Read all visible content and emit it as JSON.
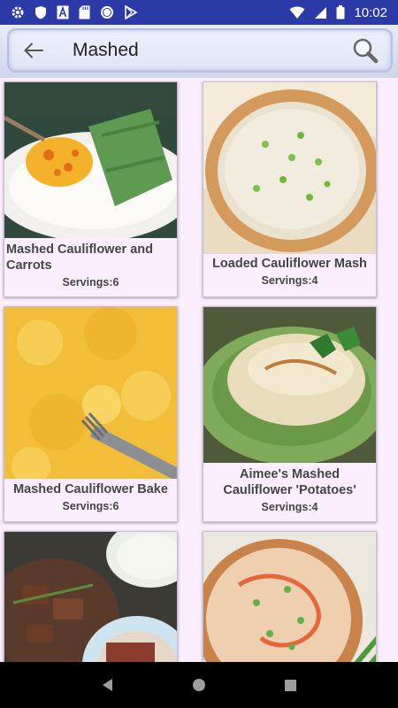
{
  "status": {
    "time": "10:02"
  },
  "search": {
    "query": "Mashed"
  },
  "recipes": [
    {
      "title": "Mashed Cauliflower and Carrots",
      "servings": "Servings:6"
    },
    {
      "title": "Loaded Cauliflower Mash",
      "servings": "Servings:4"
    },
    {
      "title": "Mashed Cauliflower Bake",
      "servings": "Servings:6"
    },
    {
      "title": "Aimee's Mashed Cauliflower 'Potatoes'",
      "servings": "Servings:4"
    },
    {
      "title": "",
      "servings": ""
    },
    {
      "title": "",
      "servings": ""
    }
  ],
  "icons": {
    "status_left": [
      "gear-icon",
      "shield-icon",
      "font-icon",
      "sd-card-icon",
      "circle-icon",
      "play-store-icon"
    ],
    "status_right": [
      "wifi-icon",
      "cell-signal-icon",
      "battery-icon"
    ],
    "search": [
      "back-arrow-icon",
      "search-icon"
    ],
    "nav": [
      "back-icon",
      "home-icon",
      "recents-icon"
    ]
  },
  "colors": {
    "status_bar": "#2c3aa8",
    "background": "#fbefff",
    "text": "#444444"
  }
}
